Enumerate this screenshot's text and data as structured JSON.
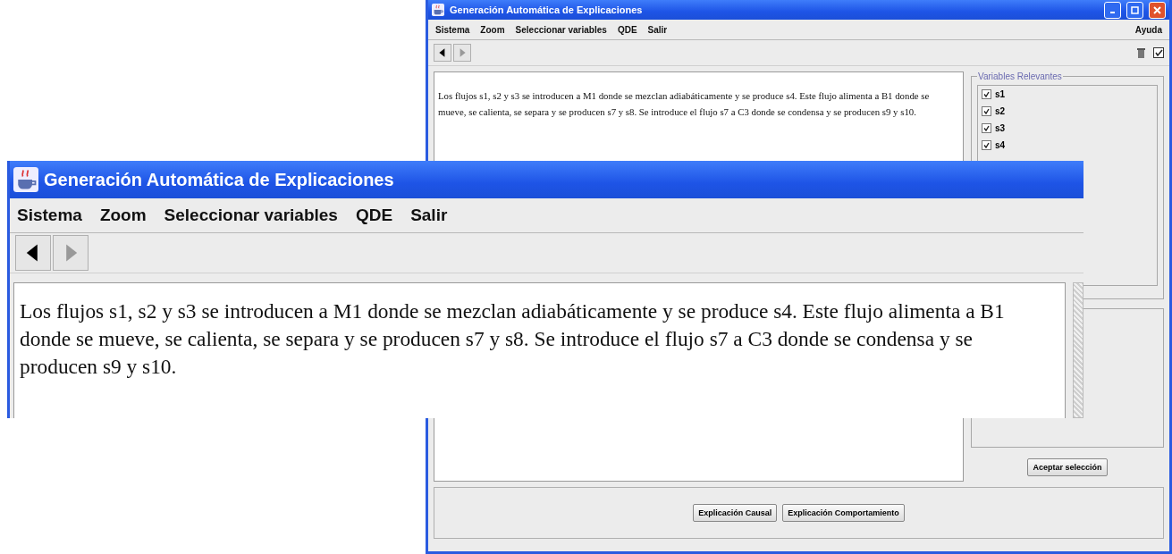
{
  "windows": [
    {
      "kind": "main",
      "title": "Generación Automática de Explicaciones",
      "menu": [
        "Sistema",
        "Zoom",
        "Seleccionar variables",
        "QDE",
        "Salir"
      ],
      "help_menu": "Ayuda",
      "text": "Los flujos s1, s2 y s3 se introducen a M1 donde se mezclan adiabáticamente y se produce s4. Este flujo alimenta a B1 donde se mueve, se calienta, se separa y se producen s7 y s8. Se introduce el flujo s7 a C3 donde se condensa y se producen s9 y s10.",
      "variables": {
        "title": "Variables Relevantes",
        "items": [
          {
            "label": "s1",
            "checked": true
          },
          {
            "label": "s2",
            "checked": true
          },
          {
            "label": "s3",
            "checked": true
          },
          {
            "label": "s4",
            "checked": true
          }
        ]
      },
      "accept_button": "Aceptar selección",
      "buttons": [
        "Explicación Causal",
        "Explicación Comportamiento"
      ]
    },
    {
      "kind": "zoom",
      "title": "Generación Automática de Explicaciones",
      "menu": [
        "Sistema",
        "Zoom",
        "Seleccionar variables",
        "QDE",
        "Salir"
      ],
      "text": "Los flujos s1, s2 y s3 se introducen a M1 donde se mezclan adiabáticamente y se produce s4. Este flujo alimenta a B1 donde se mueve, se calienta, se separa y se producen s7 y s8. Se introduce el flujo s7 a C3 donde se condensa y se producen s9 y s10."
    }
  ]
}
